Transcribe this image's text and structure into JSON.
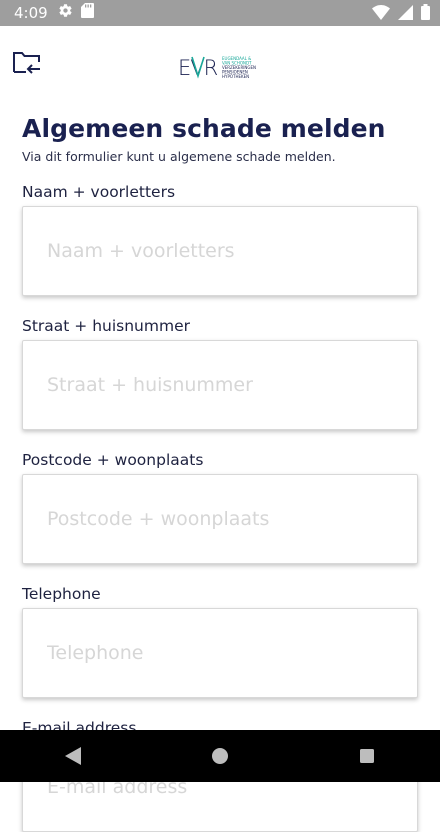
{
  "status_bar": {
    "time": "4:09"
  },
  "header": {
    "logo_letters": "EVR",
    "logo_lines": [
      "EUGENDAAL &",
      "VAN SCHONDT",
      "VERZEKERINGEN",
      "PENSIOENEN",
      "HYPOTHEKEN"
    ]
  },
  "page": {
    "title": "Algemeen schade melden",
    "subtitle": "Via dit formulier kunt u algemene schade melden."
  },
  "form": {
    "fields": [
      {
        "label": "Naam + voorletters",
        "placeholder": "Naam + voorletters"
      },
      {
        "label": "Straat + huisnummer",
        "placeholder": "Straat + huisnummer"
      },
      {
        "label": "Postcode + woonplaats",
        "placeholder": "Postcode + woonplaats"
      },
      {
        "label": "Telephone",
        "placeholder": "Telephone"
      },
      {
        "label": "E-mail address",
        "placeholder": "E-mail address"
      }
    ]
  },
  "colors": {
    "brand_navy": "#1a2150",
    "brand_teal": "#1aa89a",
    "status_bar": "#9e9e9e"
  },
  "icons": [
    "gear-icon",
    "sd-card-icon",
    "wifi-icon",
    "signal-icon",
    "battery-icon",
    "folder-back-icon",
    "back-triangle-icon",
    "home-circle-icon",
    "recents-square-icon"
  ]
}
